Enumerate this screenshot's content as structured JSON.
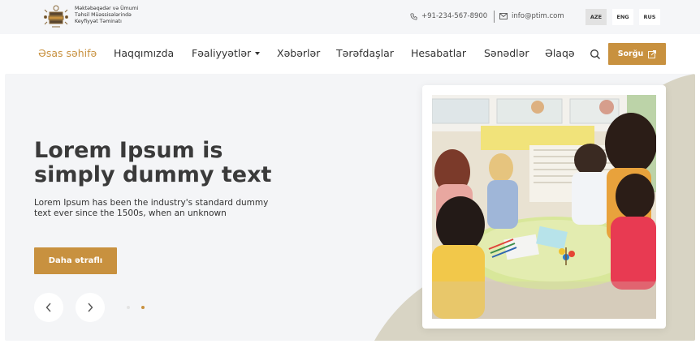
{
  "header": {
    "org_name_lines": [
      "Məktəbəqədər və Ümumi",
      "Təhsil Müəssisələrində",
      "Keyfiyyət Təminatı"
    ],
    "phone": "+91-234-567-8900",
    "email": "info@ptim.com",
    "languages": [
      {
        "code": "AZE",
        "active": true
      },
      {
        "code": "ENG",
        "active": false
      },
      {
        "code": "RUS",
        "active": false
      }
    ]
  },
  "nav": {
    "items": [
      {
        "label": "Əsas səhifə",
        "active": true
      },
      {
        "label": "Haqqımızda",
        "active": false
      },
      {
        "label": "Fəaliyyətlər",
        "active": false,
        "dropdown": true
      },
      {
        "label": "Xəbərlər",
        "active": false
      },
      {
        "label": "Tərəfdaşlar",
        "active": false
      },
      {
        "label": "Hesabatlar",
        "active": false
      },
      {
        "label": "Sənədlər",
        "active": false
      },
      {
        "label": "Əlaqə",
        "active": false
      }
    ],
    "cta_label": "Sorğu"
  },
  "hero": {
    "title": "Lorem Ipsum is simply dummy text",
    "description": "Lorem Ipsum has been the industry's standard dummy text ever since the 1500s, when an unknown",
    "button_label": "Daha ətraflı",
    "slides_total": 2,
    "active_slide": 2
  },
  "colors": {
    "accent": "#c8913f",
    "topbar_bg": "#f5f6f8",
    "hero_bg": "#f4f5f7",
    "hero_shape": "#d8d4c4"
  },
  "icons": {
    "phone": "phone-icon",
    "email": "mail-icon",
    "search": "search-icon",
    "external": "external-link-icon",
    "prev": "chevron-left-icon",
    "next": "chevron-right-icon"
  }
}
